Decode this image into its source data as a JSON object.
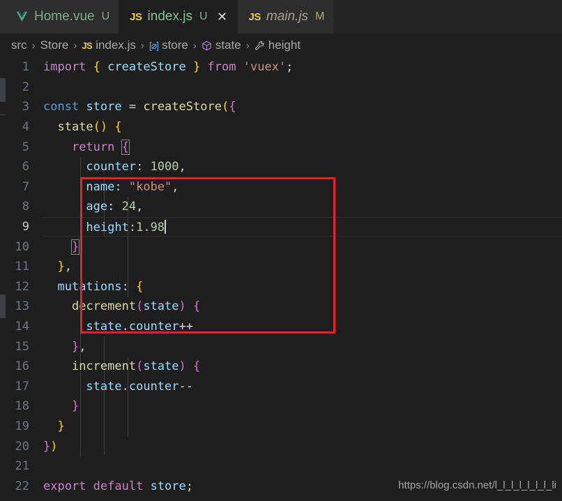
{
  "window": {
    "app": "Visual Studio Code",
    "theme_background": "#1e1e1e",
    "tabbar_background": "#252526",
    "annotation_color": "#f01f28"
  },
  "tabs": [
    {
      "icon": "vue-icon",
      "label": "Home.vue",
      "badge": "U",
      "active": false,
      "italic": false,
      "closable": false
    },
    {
      "icon": "js-icon",
      "icon_text": "JS",
      "label": "index.js",
      "badge": "U",
      "active": true,
      "italic": false,
      "closable": true,
      "close_glyph": "✕"
    },
    {
      "icon": "js-icon",
      "icon_text": "JS",
      "label": "main.js",
      "badge": "M",
      "active": false,
      "italic": true,
      "closable": false
    }
  ],
  "breadcrumb": {
    "separator": "›",
    "items": [
      {
        "label": "src",
        "icon": "none"
      },
      {
        "label": "Store",
        "icon": "none"
      },
      {
        "label": "index.js",
        "icon": "js-icon",
        "icon_text": "JS"
      },
      {
        "label": "store",
        "icon": "variable-icon",
        "icon_text": "[⌀]"
      },
      {
        "label": "state",
        "icon": "object-cube-icon"
      },
      {
        "label": "height",
        "icon": "property-wrench-icon"
      }
    ]
  },
  "editor": {
    "active_line": 9,
    "cursor_line": 9,
    "cursor_column": 18,
    "line_count": 22,
    "lines": [
      {
        "n": 1,
        "tokens": [
          {
            "t": "import",
            "c": "kw"
          },
          {
            "t": " ",
            "c": "pun"
          },
          {
            "t": "{",
            "c": "br1"
          },
          {
            "t": " ",
            "c": "pun"
          },
          {
            "t": "createStore",
            "c": "id"
          },
          {
            "t": " ",
            "c": "pun"
          },
          {
            "t": "}",
            "c": "br1"
          },
          {
            "t": " ",
            "c": "pun"
          },
          {
            "t": "from",
            "c": "kw"
          },
          {
            "t": " ",
            "c": "pun"
          },
          {
            "t": "'vuex'",
            "c": "str"
          },
          {
            "t": ";",
            "c": "pun"
          }
        ]
      },
      {
        "n": 2,
        "tokens": []
      },
      {
        "n": 3,
        "tokens": [
          {
            "t": "const",
            "c": "key"
          },
          {
            "t": " ",
            "c": "pun"
          },
          {
            "t": "store",
            "c": "id"
          },
          {
            "t": " = ",
            "c": "pun"
          },
          {
            "t": "createStore",
            "c": "fn"
          },
          {
            "t": "(",
            "c": "br1"
          },
          {
            "t": "{",
            "c": "br2"
          }
        ]
      },
      {
        "n": 4,
        "tokens": [
          {
            "t": "  ",
            "c": "pun"
          },
          {
            "t": "state",
            "c": "fn"
          },
          {
            "t": "(",
            "c": "br1"
          },
          {
            "t": ")",
            "c": "br1"
          },
          {
            "t": " ",
            "c": "pun"
          },
          {
            "t": "{",
            "c": "br1"
          }
        ]
      },
      {
        "n": 5,
        "tokens": [
          {
            "t": "    ",
            "c": "pun"
          },
          {
            "t": "return",
            "c": "kw"
          },
          {
            "t": " ",
            "c": "pun"
          },
          {
            "t": "{",
            "c": "br2",
            "box": true
          }
        ]
      },
      {
        "n": 6,
        "tokens": [
          {
            "t": "      ",
            "c": "pun"
          },
          {
            "t": "counter",
            "c": "id"
          },
          {
            "t": ": ",
            "c": "pun"
          },
          {
            "t": "1000",
            "c": "num"
          },
          {
            "t": ",",
            "c": "pun"
          }
        ]
      },
      {
        "n": 7,
        "tokens": [
          {
            "t": "      ",
            "c": "pun"
          },
          {
            "t": "name",
            "c": "id"
          },
          {
            "t": ": ",
            "c": "pun"
          },
          {
            "t": "\"kobe\"",
            "c": "str"
          },
          {
            "t": ",",
            "c": "pun"
          }
        ]
      },
      {
        "n": 8,
        "tokens": [
          {
            "t": "      ",
            "c": "pun"
          },
          {
            "t": "age",
            "c": "id"
          },
          {
            "t": ": ",
            "c": "pun"
          },
          {
            "t": "24",
            "c": "num"
          },
          {
            "t": ",",
            "c": "pun"
          }
        ]
      },
      {
        "n": 9,
        "tokens": [
          {
            "t": "      ",
            "c": "pun"
          },
          {
            "t": "height",
            "c": "id"
          },
          {
            "t": ":",
            "c": "pun"
          },
          {
            "t": "1.98",
            "c": "num"
          }
        ],
        "cursor": true
      },
      {
        "n": 10,
        "tokens": [
          {
            "t": "    ",
            "c": "pun"
          },
          {
            "t": "}",
            "c": "br2",
            "box": true
          }
        ]
      },
      {
        "n": 11,
        "tokens": [
          {
            "t": "  ",
            "c": "pun"
          },
          {
            "t": "}",
            "c": "br1"
          },
          {
            "t": ",",
            "c": "pun"
          }
        ]
      },
      {
        "n": 12,
        "tokens": [
          {
            "t": "  ",
            "c": "pun"
          },
          {
            "t": "mutations",
            "c": "id"
          },
          {
            "t": ": ",
            "c": "pun"
          },
          {
            "t": "{",
            "c": "br1"
          }
        ]
      },
      {
        "n": 13,
        "tokens": [
          {
            "t": "    ",
            "c": "pun"
          },
          {
            "t": "decrement",
            "c": "fn"
          },
          {
            "t": "(",
            "c": "br2"
          },
          {
            "t": "state",
            "c": "id"
          },
          {
            "t": ")",
            "c": "br2"
          },
          {
            "t": " ",
            "c": "pun"
          },
          {
            "t": "{",
            "c": "br2"
          }
        ]
      },
      {
        "n": 14,
        "tokens": [
          {
            "t": "      ",
            "c": "pun"
          },
          {
            "t": "state",
            "c": "id"
          },
          {
            "t": ".",
            "c": "pun"
          },
          {
            "t": "counter",
            "c": "id"
          },
          {
            "t": "++",
            "c": "pun"
          }
        ]
      },
      {
        "n": 15,
        "tokens": [
          {
            "t": "    ",
            "c": "pun"
          },
          {
            "t": "}",
            "c": "br2"
          },
          {
            "t": ",",
            "c": "pun"
          }
        ]
      },
      {
        "n": 16,
        "tokens": [
          {
            "t": "    ",
            "c": "pun"
          },
          {
            "t": "increment",
            "c": "fn"
          },
          {
            "t": "(",
            "c": "br2"
          },
          {
            "t": "state",
            "c": "id"
          },
          {
            "t": ")",
            "c": "br2"
          },
          {
            "t": " ",
            "c": "pun"
          },
          {
            "t": "{",
            "c": "br2"
          }
        ]
      },
      {
        "n": 17,
        "tokens": [
          {
            "t": "      ",
            "c": "pun"
          },
          {
            "t": "state",
            "c": "id"
          },
          {
            "t": ".",
            "c": "pun"
          },
          {
            "t": "counter",
            "c": "id"
          },
          {
            "t": "--",
            "c": "pun"
          }
        ]
      },
      {
        "n": 18,
        "tokens": [
          {
            "t": "    ",
            "c": "pun"
          },
          {
            "t": "}",
            "c": "br2"
          }
        ]
      },
      {
        "n": 19,
        "tokens": [
          {
            "t": "  ",
            "c": "pun"
          },
          {
            "t": "}",
            "c": "br1"
          }
        ]
      },
      {
        "n": 20,
        "tokens": [
          {
            "t": "}",
            "c": "br2"
          },
          {
            "t": ")",
            "c": "br1"
          }
        ]
      },
      {
        "n": 21,
        "tokens": []
      },
      {
        "n": 22,
        "tokens": [
          {
            "t": "export",
            "c": "kw"
          },
          {
            "t": " ",
            "c": "pun"
          },
          {
            "t": "default",
            "c": "kw"
          },
          {
            "t": " ",
            "c": "pun"
          },
          {
            "t": "store",
            "c": "id"
          },
          {
            "t": ";",
            "c": "pun"
          }
        ]
      }
    ]
  },
  "annotation": {
    "type": "red-rectangle",
    "covers_lines": "4-11",
    "color": "#f01f28"
  },
  "watermark": {
    "text": "https://blog.csdn.net/l_l_l_l_l_l_l_li"
  }
}
